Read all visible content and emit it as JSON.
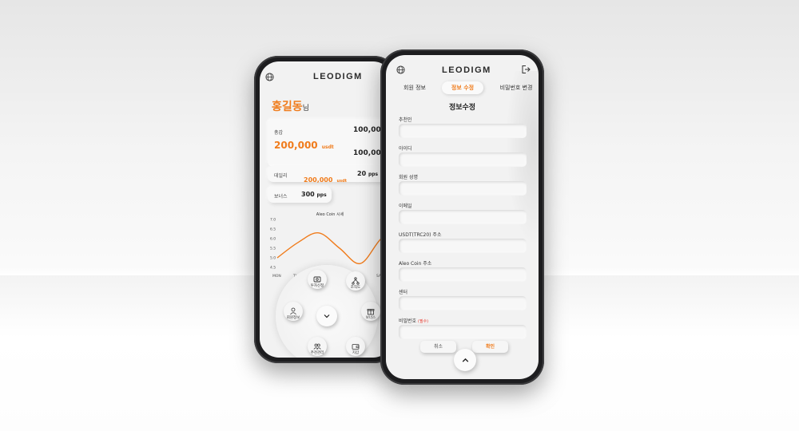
{
  "brand": {
    "logo": "LEODIGM",
    "accent": "#f07c1c",
    "required_color": "#e83a2e"
  },
  "dashboard": {
    "greeting_name": "홍길동",
    "greeting_suffix": "님",
    "total_label": "총갑",
    "total_value": "200,000",
    "total_unit": "usdt",
    "invest_label": "투자",
    "invest_value_1": "100,000",
    "invest_unit_1": "u",
    "invest_value_2": "100,000",
    "invest_unit_2": "u",
    "daily_label": "데일리",
    "daily_value": "200,000",
    "daily_unit": "usdt",
    "daily_pps": "20",
    "pps_unit": "pps",
    "bonus_label": "보너스",
    "bonus_value": "300",
    "bonus_unit": "pps"
  },
  "chart_data": {
    "type": "line",
    "title": "Aleo Coin 시세",
    "x": [
      "MON",
      "THU",
      "",
      "",
      "",
      "SAT",
      ""
    ],
    "y_ticks": [
      "7.0",
      "6.5",
      "6.0",
      "5.5",
      "5.0",
      "4.5"
    ],
    "ylim": [
      4.5,
      7.0
    ],
    "series": [
      {
        "values": [
          5.0,
          5.8,
          6.3,
          5.5,
          4.7,
          6.0,
          6.7
        ],
        "color": "#f07c1c"
      }
    ],
    "grid": false
  },
  "radial_menu": {
    "items": [
      {
        "label": "투자신청",
        "icon": "invest-icon"
      },
      {
        "label": "조직도",
        "icon": "org-chart-icon"
      },
      {
        "label": "회원정보",
        "icon": "user-icon"
      },
      {
        "label": "보너스",
        "icon": "gift-icon"
      },
      {
        "label": "추천관리",
        "icon": "users-icon"
      },
      {
        "label": "지갑",
        "icon": "wallet-icon"
      }
    ],
    "center_icon": "chevron-down-icon"
  },
  "profile_form": {
    "tabs": [
      {
        "label": "회원 정보",
        "active": false
      },
      {
        "label": "정보 수정",
        "active": true
      },
      {
        "label": "비밀번호 변경",
        "active": false
      }
    ],
    "title": "정보수정",
    "fields": [
      {
        "label": "추천인",
        "value": ""
      },
      {
        "label": "아이디",
        "value": ""
      },
      {
        "label": "회원 성명",
        "value": ""
      },
      {
        "label": "이메일",
        "value": ""
      },
      {
        "label": "USDT(TRC20) 주소",
        "value": ""
      },
      {
        "label": "Aleo Coin 주소",
        "value": ""
      },
      {
        "label": "센터",
        "value": ""
      },
      {
        "label": "비밀번호",
        "required": "(필수)",
        "value": ""
      }
    ],
    "cancel_label": "취소",
    "confirm_label": "확인"
  }
}
